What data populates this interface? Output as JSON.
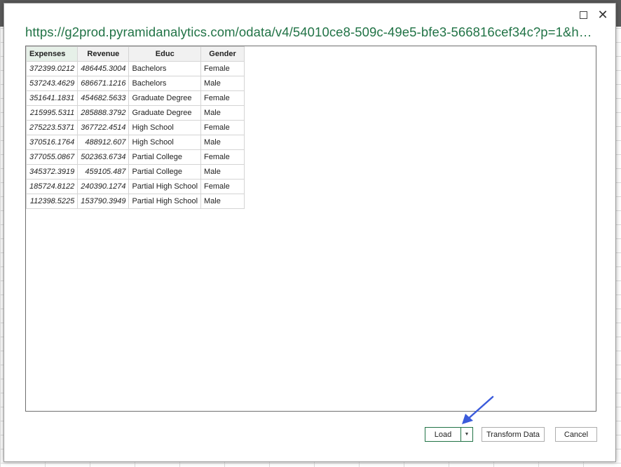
{
  "dialog": {
    "title": "https://g2prod.pyramidanalytics.com/odata/v4/54010ce8-509c-49e5-bfe3-566816cef34c?p=1&h…",
    "maximize_label": "",
    "close_label": "✕"
  },
  "table": {
    "headers": [
      "Expenses",
      "Revenue",
      "Educ",
      "Gender"
    ],
    "rows": [
      [
        "372399.0212",
        "486445.3004",
        "Bachelors",
        "Female"
      ],
      [
        "537243.4629",
        "686671.1216",
        "Bachelors",
        "Male"
      ],
      [
        "351641.1831",
        "454682.5633",
        "Graduate Degree",
        "Female"
      ],
      [
        "215995.5311",
        "285888.3792",
        "Graduate Degree",
        "Male"
      ],
      [
        "275223.5371",
        "367722.4514",
        "High School",
        "Female"
      ],
      [
        "370516.1764",
        "488912.607",
        "High School",
        "Male"
      ],
      [
        "377055.0867",
        "502363.6734",
        "Partial College",
        "Female"
      ],
      [
        "345372.3919",
        "459105.487",
        "Partial College",
        "Male"
      ],
      [
        "185724.8122",
        "240390.1274",
        "Partial High School",
        "Female"
      ],
      [
        "112398.5225",
        "153790.3949",
        "Partial High School",
        "Male"
      ]
    ]
  },
  "buttons": {
    "load": "Load",
    "load_dropdown": "▼",
    "transform": "Transform Data",
    "cancel": "Cancel"
  },
  "colors": {
    "accent": "#217346",
    "arrow": "#3b5bdb"
  }
}
